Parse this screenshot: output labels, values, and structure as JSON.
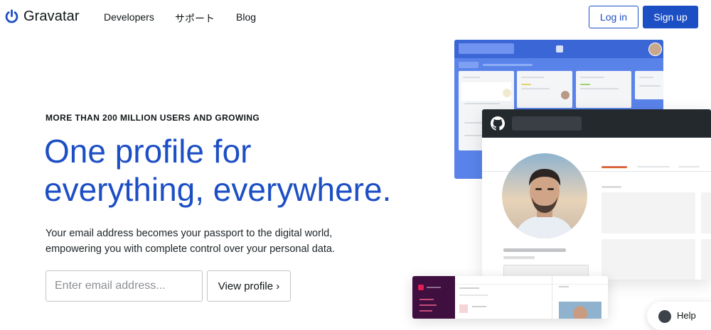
{
  "header": {
    "brand": "Gravatar",
    "nav": [
      "Developers",
      "サポート",
      "Blog"
    ],
    "login_label": "Log in",
    "signup_label": "Sign up"
  },
  "hero": {
    "eyebrow": "MORE THAN 200 MILLION USERS AND GROWING",
    "headline_line1": "One profile for",
    "headline_line2": "everything, everywhere.",
    "subtext_line1": "Your email address becomes your passport to the digital world,",
    "subtext_line2": "empowering you with complete control over your personal data.",
    "email_placeholder": "Enter email address...",
    "view_profile_label": "View profile ›"
  },
  "help": {
    "label": "Help"
  },
  "colors": {
    "brand_blue": "#1d4fc4",
    "github_dark": "#24292e",
    "slack_purple": "#3f0f3f",
    "trello_blue": "#5a83ea"
  }
}
